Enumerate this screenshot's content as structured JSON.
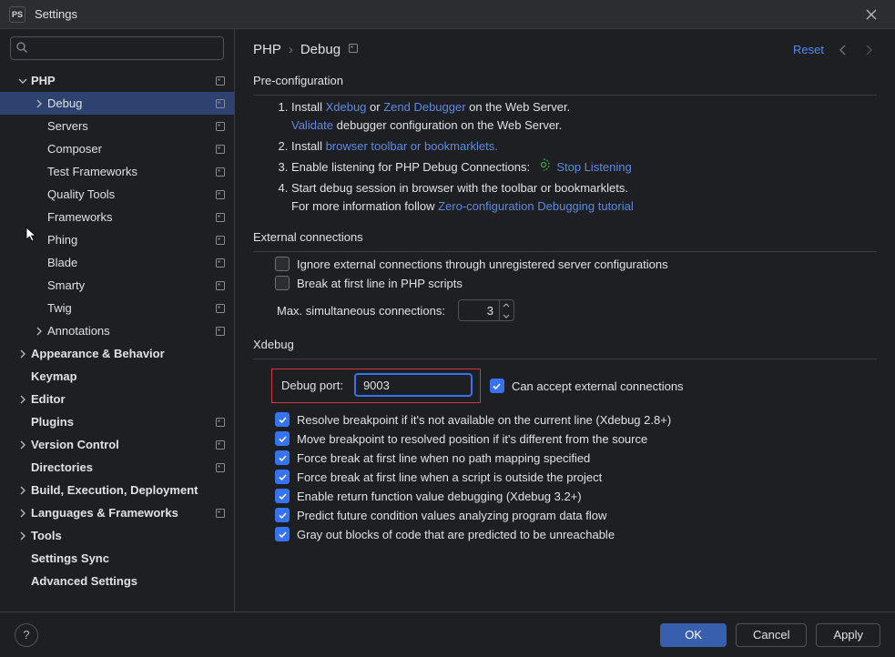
{
  "window": {
    "title": "Settings",
    "app_icon_text": "PS"
  },
  "search": {
    "placeholder": ""
  },
  "sidebar": {
    "items": [
      {
        "label": "PHP",
        "level": 0,
        "bold": true,
        "expandable": true,
        "expanded": true,
        "scope": true
      },
      {
        "label": "Debug",
        "level": 1,
        "bold": false,
        "expandable": true,
        "expanded": false,
        "scope": true,
        "selected": true
      },
      {
        "label": "Servers",
        "level": 1,
        "scope": true
      },
      {
        "label": "Composer",
        "level": 1,
        "scope": true
      },
      {
        "label": "Test Frameworks",
        "level": 1,
        "scope": true
      },
      {
        "label": "Quality Tools",
        "level": 1,
        "scope": true
      },
      {
        "label": "Frameworks",
        "level": 1,
        "scope": true
      },
      {
        "label": "Phing",
        "level": 1,
        "scope": true
      },
      {
        "label": "Blade",
        "level": 1,
        "scope": true
      },
      {
        "label": "Smarty",
        "level": 1,
        "scope": true
      },
      {
        "label": "Twig",
        "level": 1,
        "scope": true
      },
      {
        "label": "Annotations",
        "level": 1,
        "expandable": true,
        "expanded": false,
        "scope": true
      },
      {
        "label": "Appearance & Behavior",
        "level": 0,
        "bold": true,
        "expandable": true,
        "expanded": false
      },
      {
        "label": "Keymap",
        "level": 0,
        "bold": true
      },
      {
        "label": "Editor",
        "level": 0,
        "bold": true,
        "expandable": true,
        "expanded": false
      },
      {
        "label": "Plugins",
        "level": 0,
        "bold": true,
        "scope": true
      },
      {
        "label": "Version Control",
        "level": 0,
        "bold": true,
        "expandable": true,
        "expanded": false,
        "scope": true
      },
      {
        "label": "Directories",
        "level": 0,
        "bold": true,
        "scope": true
      },
      {
        "label": "Build, Execution, Deployment",
        "level": 0,
        "bold": true,
        "expandable": true,
        "expanded": false
      },
      {
        "label": "Languages & Frameworks",
        "level": 0,
        "bold": true,
        "expandable": true,
        "expanded": false,
        "scope": true
      },
      {
        "label": "Tools",
        "level": 0,
        "bold": true,
        "expandable": true,
        "expanded": false
      },
      {
        "label": "Settings Sync",
        "level": 0,
        "bold": true
      },
      {
        "label": "Advanced Settings",
        "level": 0,
        "bold": true
      }
    ]
  },
  "breadcrumb": {
    "root": "PHP",
    "leaf": "Debug"
  },
  "actions": {
    "reset": "Reset"
  },
  "preconfig": {
    "title": "Pre-configuration",
    "step1_prefix": "Install ",
    "step1_link1": "Xdebug",
    "step1_mid": " or ",
    "step1_link2": "Zend Debugger",
    "step1_suffix": " on the Web Server.",
    "step1_sub_link": "Validate",
    "step1_sub_suffix": " debugger configuration on the Web Server.",
    "step2_prefix": "Install ",
    "step2_link": "browser toolbar or bookmarklets.",
    "step3_prefix": "Enable listening for PHP Debug Connections:  ",
    "step3_link": "Stop Listening",
    "step4_line1": "Start debug session in browser with the toolbar or bookmarklets.",
    "step4_line2_prefix": "For more information follow ",
    "step4_link": "Zero-configuration Debugging tutorial"
  },
  "external": {
    "title": "External connections",
    "opt1": "Ignore external connections through unregistered server configurations",
    "opt2": "Break at first line in PHP scripts",
    "max_label": "Max. simultaneous connections:",
    "max_value": "3"
  },
  "xdebug": {
    "title": "Xdebug",
    "port_label": "Debug port:",
    "port_value": "9003",
    "accept_ext": "Can accept external connections",
    "opts": [
      "Resolve breakpoint if it's not available on the current line (Xdebug 2.8+)",
      "Move breakpoint to resolved position if it's different from the source",
      "Force break at first line when no path mapping specified",
      "Force break at first line when a script is outside the project",
      "Enable return function value debugging (Xdebug 3.2+)",
      "Predict future condition values analyzing program data flow",
      "Gray out blocks of code that are predicted to be unreachable"
    ]
  },
  "footer": {
    "ok": "OK",
    "cancel": "Cancel",
    "apply": "Apply",
    "help": "?"
  }
}
